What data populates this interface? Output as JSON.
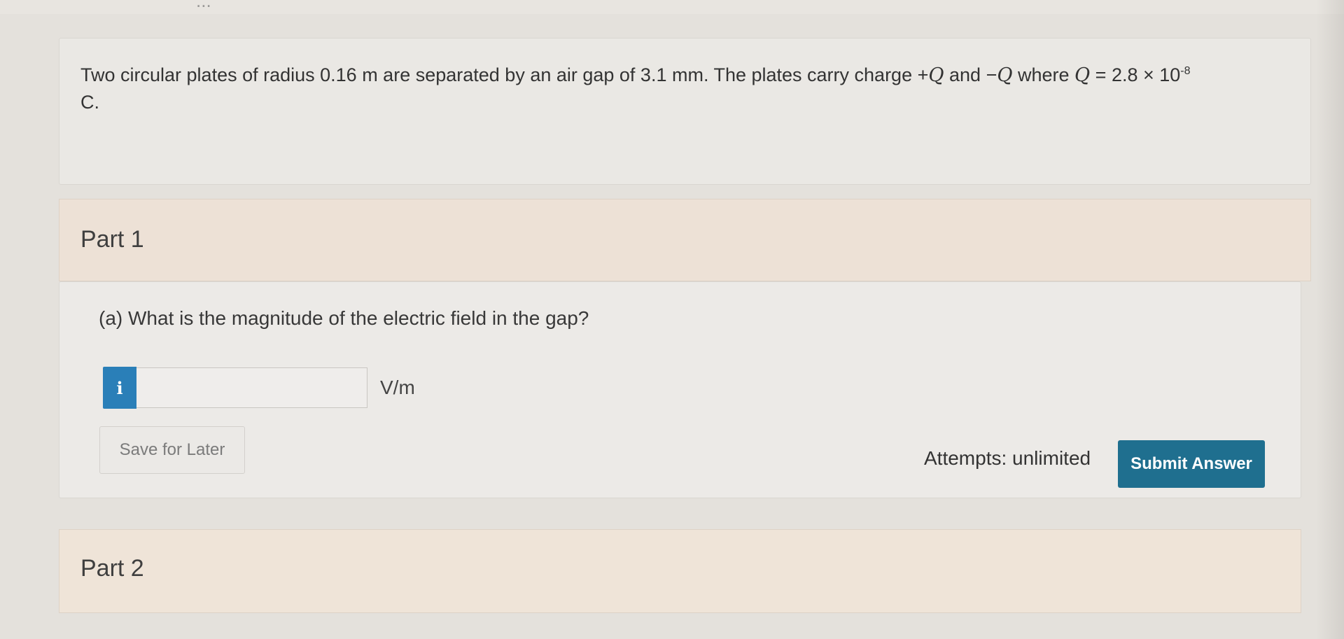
{
  "top": {
    "partial_text": "..."
  },
  "question": {
    "line_a": "Two circular plates of radius 0.16 m are separated by an air gap of 3.1 mm. The plates carry charge +",
    "q_symbol_1": "Q",
    "and_text": " and −",
    "q_symbol_2": "Q",
    "where_text": " where ",
    "q_symbol_3": "Q",
    "equals_text": " = 2.8 × 10",
    "exponent": "-8",
    "line_b": "C."
  },
  "part1": {
    "title": "Part 1",
    "sub_question": "(a) What is the magnitude of the electric field in the gap?",
    "info_icon": "i",
    "answer_value": "",
    "unit": "V/m",
    "save_label": "Save for Later",
    "attempts_label": "Attempts: unlimited",
    "submit_label": "Submit Answer"
  },
  "part2": {
    "title": "Part 2"
  },
  "colors": {
    "accent_info": "#2a7fb8",
    "submit_bg": "#1f6f8f",
    "part_header_bg": "#ede1d6"
  }
}
